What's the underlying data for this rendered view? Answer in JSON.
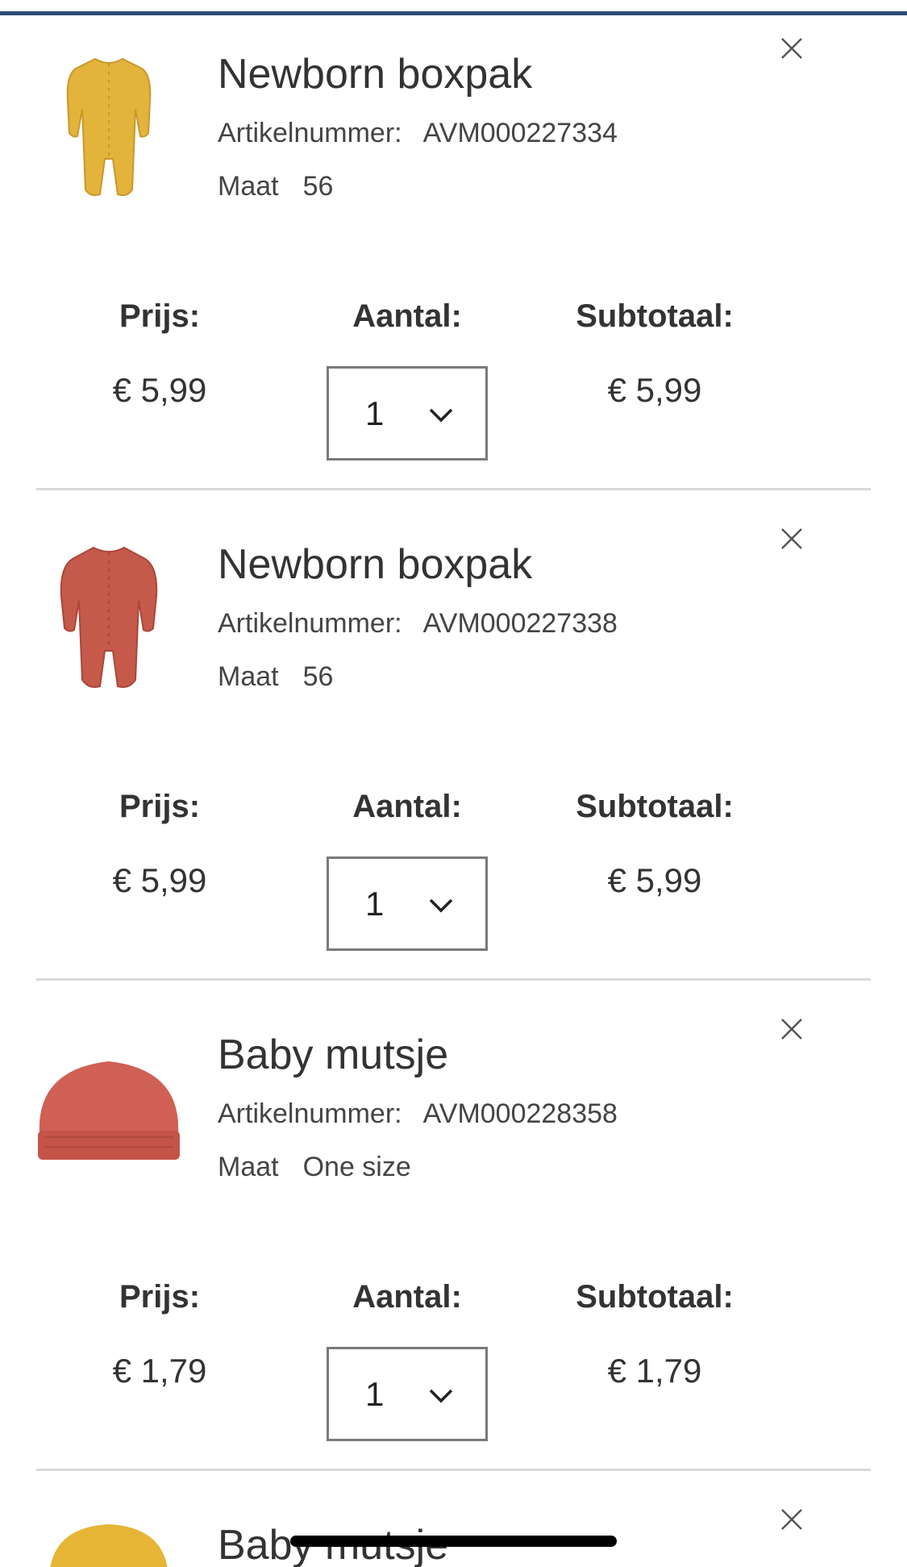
{
  "colors": {
    "top_bar": "#2c4a78",
    "text": "#333333",
    "divider": "#d9d9d9"
  },
  "labels": {
    "sku": "Artikelnummer:",
    "size": "Maat",
    "price": "Prijs:",
    "quantity": "Aantal:",
    "subtotal": "Subtotaal:"
  },
  "cart": {
    "items": [
      {
        "name": "Newborn boxpak",
        "sku": "AVM000227334",
        "size": "56",
        "price": "€ 5,99",
        "quantity": "1",
        "subtotal": "€ 5,99",
        "image": "yellow-onesie",
        "image_color": "#e3b33c"
      },
      {
        "name": "Newborn boxpak",
        "sku": "AVM000227338",
        "size": "56",
        "price": "€ 5,99",
        "quantity": "1",
        "subtotal": "€ 5,99",
        "image": "rust-onesie",
        "image_color": "#c65a4a"
      },
      {
        "name": "Baby mutsje",
        "sku": "AVM000228358",
        "size": "One size",
        "price": "€ 1,79",
        "quantity": "1",
        "subtotal": "€ 1,79",
        "image": "rust-beanie",
        "image_color": "#cf6053"
      },
      {
        "name": "Baby mutsje",
        "image": "yellow-beanie",
        "image_color": "#e6b535"
      }
    ]
  }
}
